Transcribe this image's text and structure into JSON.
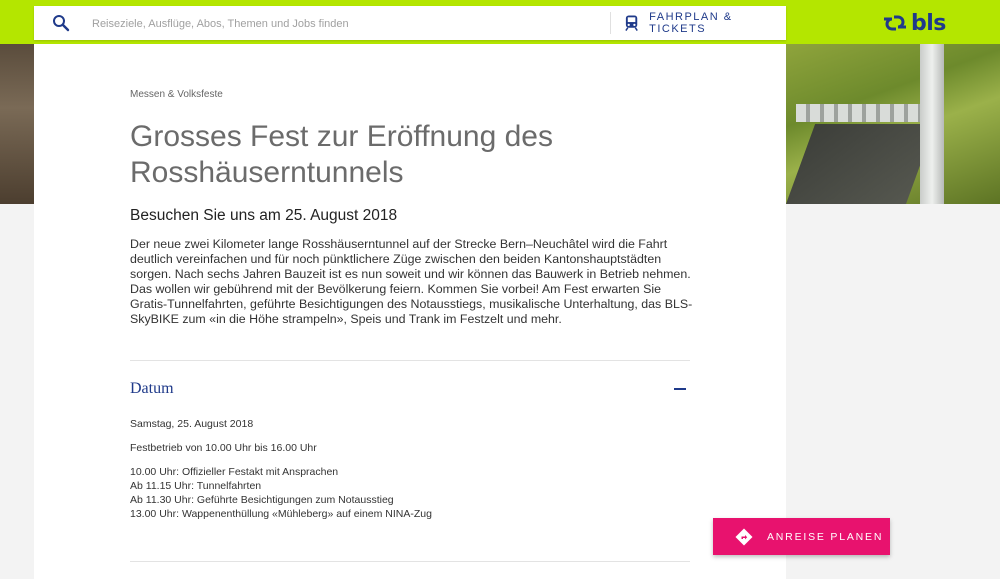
{
  "header": {
    "search_placeholder": "Reiseziele, Ausflüge, Abos, Themen und Jobs finden",
    "fahrplan_label": "FAHRPLAN & TICKETS",
    "logo_text": "bls",
    "accent_color": "#b4e600",
    "brand_color": "#1f3a8a"
  },
  "article": {
    "breadcrumb": "Messen & Volksfeste",
    "title": "Grosses Fest zur Eröffnung des Rosshäuserntunnels",
    "subtitle": "Besuchen Sie uns am 25. August 2018",
    "intro": "Der neue zwei Kilometer lange Rosshäuserntunnel auf der Strecke Bern–Neuchâtel wird die Fahrt deutlich vereinfachen und für noch pünktlichere Züge zwischen den beiden Kantonshauptstädten sorgen. Nach sechs Jahren Bauzeit ist es nun soweit und wir können das Bauwerk in Betrieb nehmen. Das wollen wir gebührend mit der Bevölkerung feiern. Kommen Sie vorbei! Am Fest erwarten Sie Gratis-Tunnelfahrten, geführte Besichtigungen des Notausstiegs, musikalische Unterhaltung, das BLS-SkyBIKE zum «in die Höhe strampeln», Speis und Trank im Festzelt und mehr."
  },
  "accordion": {
    "title": "Datum",
    "toggle_icon": "minus-icon",
    "date": "Samstag, 25. August 2018",
    "hours": "Festbetrieb von 10.00 Uhr bis 16.00 Uhr",
    "schedule": [
      "10.00 Uhr: Offizieller Festakt mit Ansprachen",
      "Ab 11.15 Uhr: Tunnelfahrten",
      "Ab 11.30 Uhr: Geführte Besichtigungen zum Notausstieg",
      "13.00 Uhr: Wappenenthüllung «Mühleberg» auf einem NINA-Zug"
    ]
  },
  "cta": {
    "label": "ANREISE PLANEN",
    "icon": "directions-icon",
    "color": "#e8126e"
  }
}
